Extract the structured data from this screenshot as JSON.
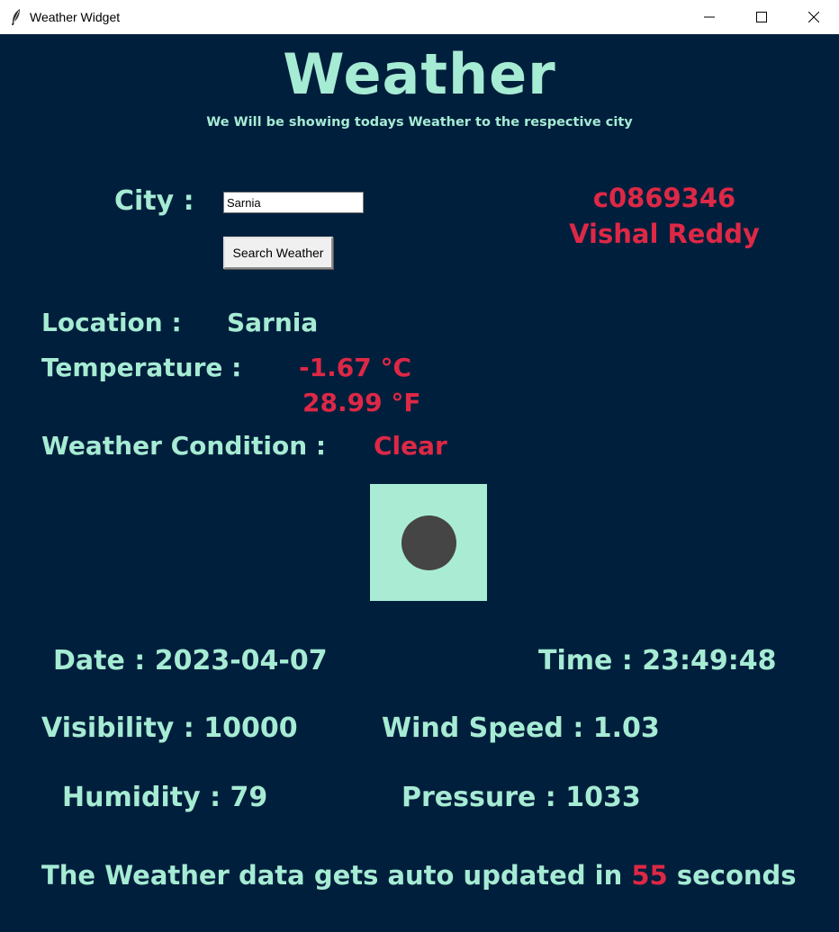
{
  "window": {
    "title": "Weather Widget"
  },
  "header": {
    "title": "Weather",
    "subtitle": "We Will be showing todays Weather to the respective city"
  },
  "search": {
    "city_label": "City :",
    "city_value": "Sarnia",
    "button_label": "Search Weather"
  },
  "student": {
    "id": "c0869346",
    "name": "Vishal Reddy"
  },
  "weather": {
    "location_label": "Location :",
    "location_value": "Sarnia",
    "temperature_label": "Temperature :",
    "temp_c": "-1.67 °C",
    "temp_f": "28.99 °F",
    "condition_label": "Weather Condition :",
    "condition_value": "Clear",
    "icon": "clear-weather-icon"
  },
  "details": {
    "date": "Date : 2023-04-07",
    "time": "Time : 23:49:48",
    "visibility": "Visibility : 10000",
    "wind_speed": "Wind Speed : 1.03",
    "humidity": "Humidity : 79",
    "pressure": "Pressure : 1033"
  },
  "footer": {
    "prefix": "The Weather data gets auto updated in ",
    "seconds": "55",
    "suffix": " seconds"
  },
  "colors": {
    "background": "#001f3c",
    "text": "#a6ebd4",
    "accent": "#dd2846",
    "icon_bg": "#a9ecd3",
    "icon_dot": "#454545"
  }
}
